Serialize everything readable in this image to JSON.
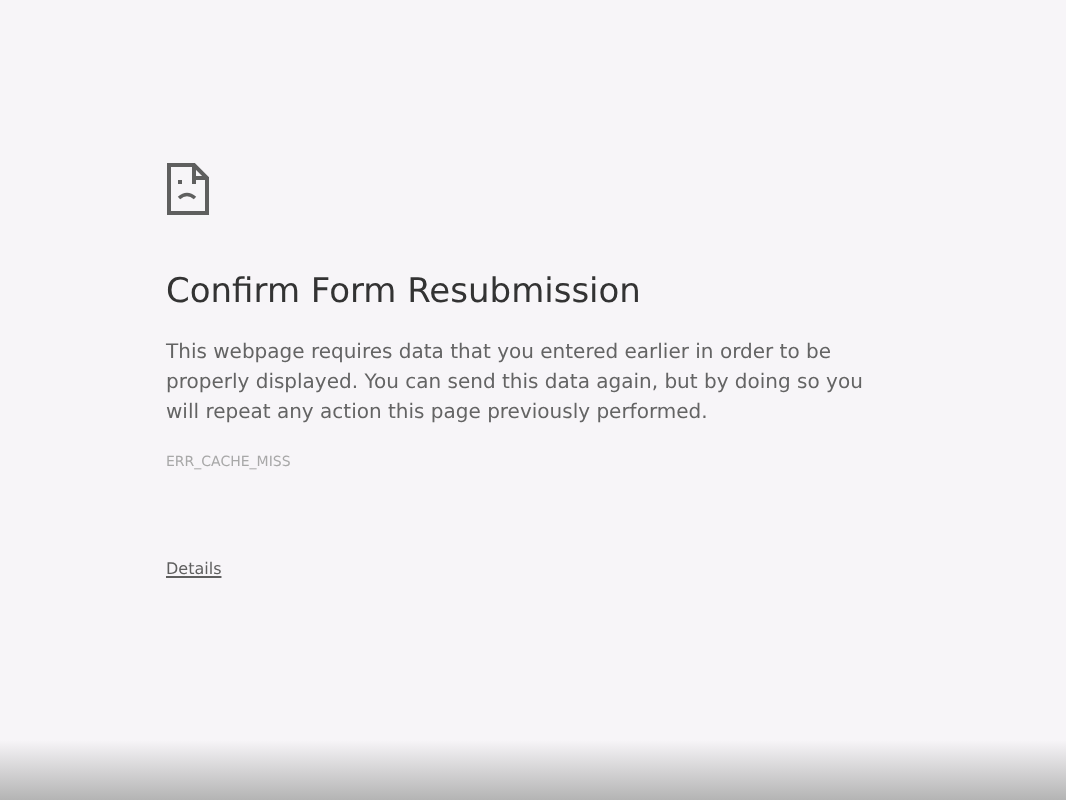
{
  "heading": "Confirm Form Resubmission",
  "message": "This webpage requires data that you entered earlier in order to be properly displayed. You can send this data again, but by doing so you will repeat any action this page previously performed.",
  "error_code": "ERR_CACHE_MISS",
  "details_link": "Details"
}
